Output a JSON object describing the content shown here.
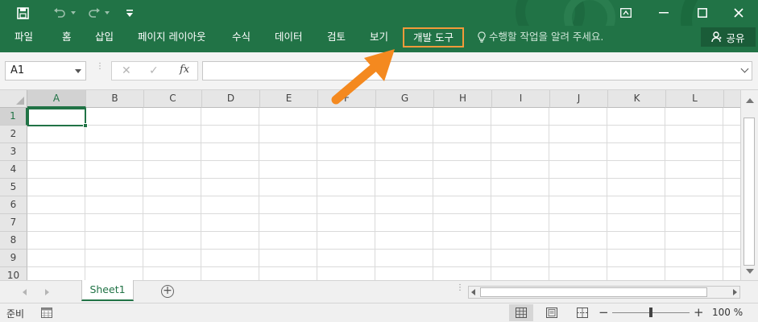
{
  "ribbon": {
    "tabs": [
      {
        "label": "파일"
      },
      {
        "label": "홈"
      },
      {
        "label": "삽입"
      },
      {
        "label": "페이지 레이아웃"
      },
      {
        "label": "수식"
      },
      {
        "label": "데이터"
      },
      {
        "label": "검토"
      },
      {
        "label": "보기"
      },
      {
        "label": "개발 도구",
        "highlighted": true
      }
    ],
    "tell_me_placeholder": "수행할 작업을 알려 주세요.",
    "share_label": "공유"
  },
  "titlebar": {
    "icons": [
      "save-icon",
      "undo-icon",
      "redo-icon",
      "customize-qat-icon",
      "ribbon-display-options-icon",
      "minimize-icon",
      "maximize-icon",
      "close-icon"
    ]
  },
  "formula_bar": {
    "name_box": "A1",
    "formula_value": "",
    "fx_label": "fx",
    "cancel_icon": "cancel-icon",
    "enter_icon": "check-icon"
  },
  "grid": {
    "columns": [
      "A",
      "B",
      "C",
      "D",
      "E",
      "F",
      "G",
      "H",
      "I",
      "J",
      "K",
      "L"
    ],
    "rows": [
      "1",
      "2",
      "3",
      "4",
      "5",
      "6",
      "7",
      "8",
      "9",
      "10"
    ],
    "selected_cell": "A1"
  },
  "sheets": {
    "tabs": [
      "Sheet1"
    ],
    "active": "Sheet1",
    "add_icon": "plus-circle-icon"
  },
  "status_bar": {
    "status": "준비",
    "zoom_label": "100 %",
    "zoom_minus": "−",
    "zoom_plus": "+",
    "zoom_level": 1.0
  },
  "colors": {
    "brand": "#217346",
    "highlight_border": "#f29a3a",
    "annotation_arrow": "#f4891f"
  },
  "annotation": {
    "type": "arrow",
    "points_to": "개발 도구"
  }
}
